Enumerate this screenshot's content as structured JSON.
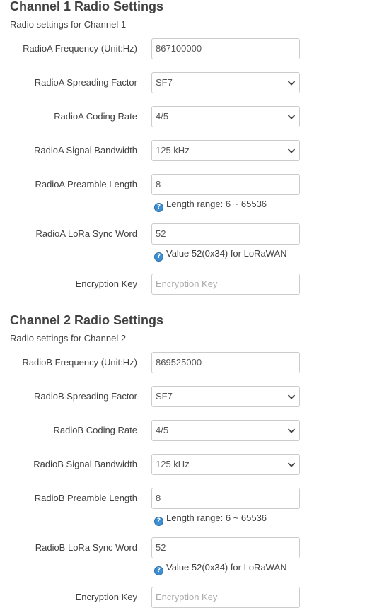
{
  "channel1": {
    "title": "Channel 1 Radio Settings",
    "description": "Radio settings for Channel 1",
    "frequency": {
      "label": "RadioA Frequency (Unit:Hz)",
      "value": "867100000"
    },
    "spreading_factor": {
      "label": "RadioA Spreading Factor",
      "value": "SF7"
    },
    "coding_rate": {
      "label": "RadioA Coding Rate",
      "value": "4/5"
    },
    "bandwidth": {
      "label": "RadioA Signal Bandwidth",
      "value": "125 kHz"
    },
    "preamble_length": {
      "label": "RadioA Preamble Length",
      "value": "8",
      "hint": "Length range: 6 ~ 65536"
    },
    "sync_word": {
      "label": "RadioA LoRa Sync Word",
      "value": "52",
      "hint": "Value 52(0x34) for LoRaWAN"
    },
    "encryption_key": {
      "label": "Encryption Key",
      "placeholder": "Encryption Key"
    }
  },
  "channel2": {
    "title": "Channel 2 Radio Settings",
    "description": "Radio settings for Channel 2",
    "frequency": {
      "label": "RadioB Frequency (Unit:Hz)",
      "value": "869525000"
    },
    "spreading_factor": {
      "label": "RadioB Spreading Factor",
      "value": "SF7"
    },
    "coding_rate": {
      "label": "RadioB Coding Rate",
      "value": "4/5"
    },
    "bandwidth": {
      "label": "RadioB Signal Bandwidth",
      "value": "125 kHz"
    },
    "preamble_length": {
      "label": "RadioB Preamble Length",
      "value": "8",
      "hint": "Length range: 6 ~ 65536"
    },
    "sync_word": {
      "label": "RadioB LoRa Sync Word",
      "value": "52",
      "hint": "Value 52(0x34) for LoRaWAN"
    },
    "encryption_key": {
      "label": "Encryption Key",
      "placeholder": "Encryption Key"
    }
  },
  "icons": {
    "help": "help-icon",
    "dropdown": "chevron-down-icon"
  },
  "colors": {
    "help_icon": "#3d8fd1",
    "border": "#cccccc",
    "text": "#404040"
  }
}
